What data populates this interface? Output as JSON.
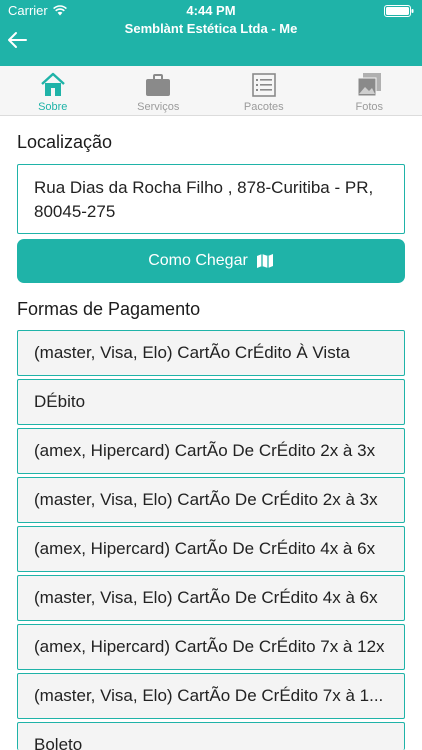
{
  "status_bar": {
    "carrier": "Carrier",
    "time": "4:44 PM"
  },
  "header": {
    "title": "Semblànt Estética Ltda - Me"
  },
  "colors": {
    "accent": "#1fb3a8"
  },
  "tabs": [
    {
      "label": "Sobre",
      "icon": "home-icon",
      "active": true
    },
    {
      "label": "Serviços",
      "icon": "briefcase-icon",
      "active": false
    },
    {
      "label": "Pacotes",
      "icon": "list-icon",
      "active": false
    },
    {
      "label": "Fotos",
      "icon": "photos-icon",
      "active": false
    }
  ],
  "location": {
    "heading": "Localização",
    "address_line1": "Rua Dias da Rocha Filho , 878-Curitiba - PR,",
    "address_line2": "80045-275",
    "directions_label": "Como Chegar"
  },
  "payment": {
    "heading": "Formas de Pagamento",
    "items": [
      "(master, Visa, Elo) CartÃo CrÉdito À Vista",
      "DÉbito",
      "(amex, Hipercard) CartÃo De CrÉdito 2x à 3x",
      "(master, Visa, Elo) CartÃo De CrÉdito 2x à 3x",
      "(amex, Hipercard) CartÃo De CrÉdito 4x à 6x",
      "(master, Visa, Elo) CartÃo De CrÉdito 4x à 6x",
      "(amex, Hipercard) CartÃo De CrÉdito 7x à 12x",
      "(master, Visa, Elo) CartÃo De CrÉdito 7x à 1...",
      "Boleto"
    ]
  }
}
